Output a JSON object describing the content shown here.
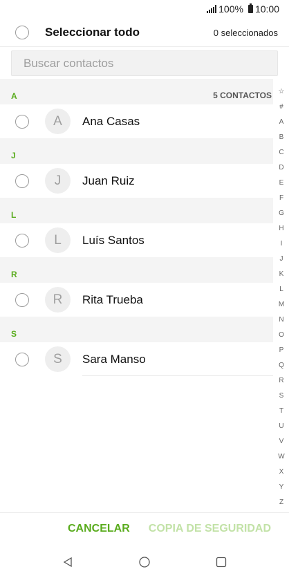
{
  "status_bar": {
    "battery": "100%",
    "time": "10:00"
  },
  "header": {
    "select_all": "Seleccionar todo",
    "selected_count": "0 seleccionados"
  },
  "search": {
    "placeholder": "Buscar contactos"
  },
  "sections": [
    {
      "letter": "A",
      "count": "5 CONTACTOS",
      "contact": {
        "initial": "A",
        "name": "Ana Casas"
      }
    },
    {
      "letter": "J",
      "contact": {
        "initial": "J",
        "name": "Juan Ruiz"
      }
    },
    {
      "letter": "L",
      "contact": {
        "initial": "L",
        "name": "Luís Santos"
      }
    },
    {
      "letter": "R",
      "contact": {
        "initial": "R",
        "name": "Rita Trueba"
      }
    },
    {
      "letter": "S",
      "contact": {
        "initial": "S",
        "name": "Sara Manso"
      }
    }
  ],
  "index": [
    "☆",
    "#",
    "A",
    "B",
    "C",
    "D",
    "E",
    "F",
    "G",
    "H",
    "I",
    "J",
    "K",
    "L",
    "M",
    "N",
    "O",
    "P",
    "Q",
    "R",
    "S",
    "T",
    "U",
    "V",
    "W",
    "X",
    "Y",
    "Z"
  ],
  "buttons": {
    "cancel": "CANCELAR",
    "backup": "COPIA DE SEGURIDAD"
  },
  "colors": {
    "accent": "#5aac1e",
    "accent_disabled": "#c2e2a7"
  },
  "icons": {
    "nav_back": "back-triangle-icon",
    "nav_home": "home-circle-icon",
    "nav_recents": "recents-square-icon"
  }
}
